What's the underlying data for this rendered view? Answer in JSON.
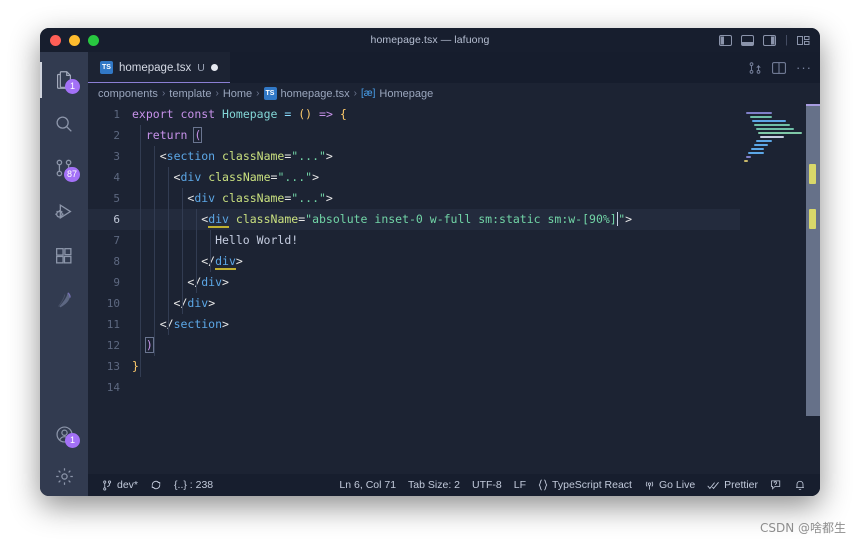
{
  "window": {
    "title": "homepage.tsx — lafuong",
    "traffic_lights": [
      "close",
      "minimize",
      "zoom"
    ],
    "layout_icons": [
      "toggle-primary-sidebar",
      "toggle-panel",
      "toggle-secondary-sidebar",
      "customize-layout"
    ]
  },
  "activitybar": {
    "items": [
      {
        "name": "explorer",
        "icon": "files-icon",
        "badge": "1",
        "active": true
      },
      {
        "name": "search",
        "icon": "search-icon",
        "badge": "",
        "active": false
      },
      {
        "name": "source-control",
        "icon": "source-control-icon",
        "badge": "87",
        "active": false
      },
      {
        "name": "run-and-debug",
        "icon": "run-debug-icon",
        "badge": "",
        "active": false
      },
      {
        "name": "extensions",
        "icon": "extensions-icon",
        "badge": "",
        "active": false
      },
      {
        "name": "feather-extension",
        "icon": "feather-icon",
        "badge": "",
        "active": false
      }
    ],
    "bottom_items": [
      {
        "name": "accounts",
        "icon": "account-icon",
        "badge": "1"
      },
      {
        "name": "manage",
        "icon": "gear-icon",
        "badge": ""
      }
    ]
  },
  "tabs": [
    {
      "label": "homepage.tsx",
      "badge": "U",
      "dirty": true,
      "icon": "ts-icon",
      "icon_text": "TS",
      "active": true
    }
  ],
  "editor_actions": [
    "open-changes-icon",
    "split-editor-icon",
    "more-actions-icon"
  ],
  "editor_actions_more": "···",
  "breadcrumb": {
    "items": [
      {
        "label": "components",
        "icon": ""
      },
      {
        "label": "template",
        "icon": ""
      },
      {
        "label": "Home",
        "icon": ""
      },
      {
        "label": "homepage.tsx",
        "icon": "ts-icon",
        "icon_text": "TS"
      },
      {
        "label": "Homepage",
        "icon": "symbol-class-icon",
        "icon_text": "[æ]"
      }
    ],
    "separator": "›"
  },
  "code": {
    "language": "TypeScript React",
    "current_line": 6,
    "lines": [
      {
        "n": "1",
        "text": "export const Homepage = () => {"
      },
      {
        "n": "2",
        "text": "  return ("
      },
      {
        "n": "3",
        "text": "    <section className=\"...\">"
      },
      {
        "n": "4",
        "text": "      <div className=\"...\">"
      },
      {
        "n": "5",
        "text": "        <div className=\"...\">"
      },
      {
        "n": "6",
        "text": "          <div className=\"absolute inset-0 w-full sm:static sm:w-[90%]\">"
      },
      {
        "n": "7",
        "text": "            Hello World!"
      },
      {
        "n": "8",
        "text": "          </div>"
      },
      {
        "n": "9",
        "text": "        </div>"
      },
      {
        "n": "10",
        "text": "      </div>"
      },
      {
        "n": "11",
        "text": "    </section>"
      },
      {
        "n": "12",
        "text": "  )"
      },
      {
        "n": "13",
        "text": "}"
      },
      {
        "n": "14",
        "text": ""
      }
    ]
  },
  "statusbar": {
    "left": [
      {
        "name": "remote-branch",
        "icon": "branch-icon",
        "label": "dev*"
      },
      {
        "name": "sync-changes",
        "icon": "sync-icon",
        "label": ""
      },
      {
        "name": "problems-or-size",
        "icon": "",
        "label": "{..} : 238"
      }
    ],
    "right": [
      {
        "name": "cursor-position",
        "icon": "",
        "label": "Ln 6, Col 71"
      },
      {
        "name": "indentation",
        "icon": "",
        "label": "Tab Size: 2"
      },
      {
        "name": "encoding",
        "icon": "",
        "label": "UTF-8"
      },
      {
        "name": "eol",
        "icon": "",
        "label": "LF"
      },
      {
        "name": "language-mode",
        "icon": "braces-icon",
        "label": "TypeScript React"
      },
      {
        "name": "go-live",
        "icon": "broadcast-icon",
        "label": "Go Live"
      },
      {
        "name": "prettier",
        "icon": "checks-icon",
        "label": "Prettier"
      },
      {
        "name": "feedback",
        "icon": "feedback-icon",
        "label": ""
      },
      {
        "name": "notifications",
        "icon": "bell-icon",
        "label": ""
      }
    ]
  },
  "watermark": "CSDN @啥都生",
  "colors": {
    "window_bg": "#1c2333",
    "titlebar_bg": "#171e2e",
    "activitybar_bg": "#323b50",
    "tabbar_bg": "#161d2e",
    "tab_active_border": "#8b7fd4",
    "badge_bg": "#a371f7",
    "keyword": "#c792ea",
    "tag": "#5ca7e6",
    "attribute": "#c9e07f",
    "string": "#71d4a6",
    "function": "#82d6d6",
    "bracket_yellow": "#ffcb6b",
    "scroll_mark": "#d9d86a"
  }
}
